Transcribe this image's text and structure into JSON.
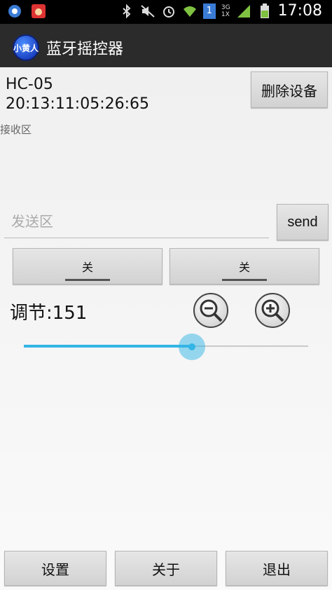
{
  "status_bar": {
    "time": "17:08",
    "network_label": "3G\n1X",
    "sim_badge": "1",
    "icons": [
      "notification-icon",
      "app-notification-icon",
      "bluetooth-icon",
      "mute-icon",
      "alarm-icon",
      "wifi-icon",
      "sim-icon",
      "signal-icon",
      "battery-icon"
    ]
  },
  "action_bar": {
    "app_icon_text": "小黄人",
    "title": "蓝牙摇控器"
  },
  "device": {
    "name": "HC-05",
    "address": "20:13:11:05:26:65",
    "delete_label": "删除设备"
  },
  "receive": {
    "label": "接收区"
  },
  "send": {
    "placeholder": "发送区",
    "button_label": "send"
  },
  "toggles": [
    {
      "label": "关"
    },
    {
      "label": "关"
    }
  ],
  "adjust": {
    "label": "调节:151",
    "slider_fraction": 0.59
  },
  "bottom_bar": {
    "settings_label": "设置",
    "about_label": "关于",
    "exit_label": "退出"
  },
  "colors": {
    "accent": "#33b5e5",
    "action_bar": "#2b2b2b"
  }
}
